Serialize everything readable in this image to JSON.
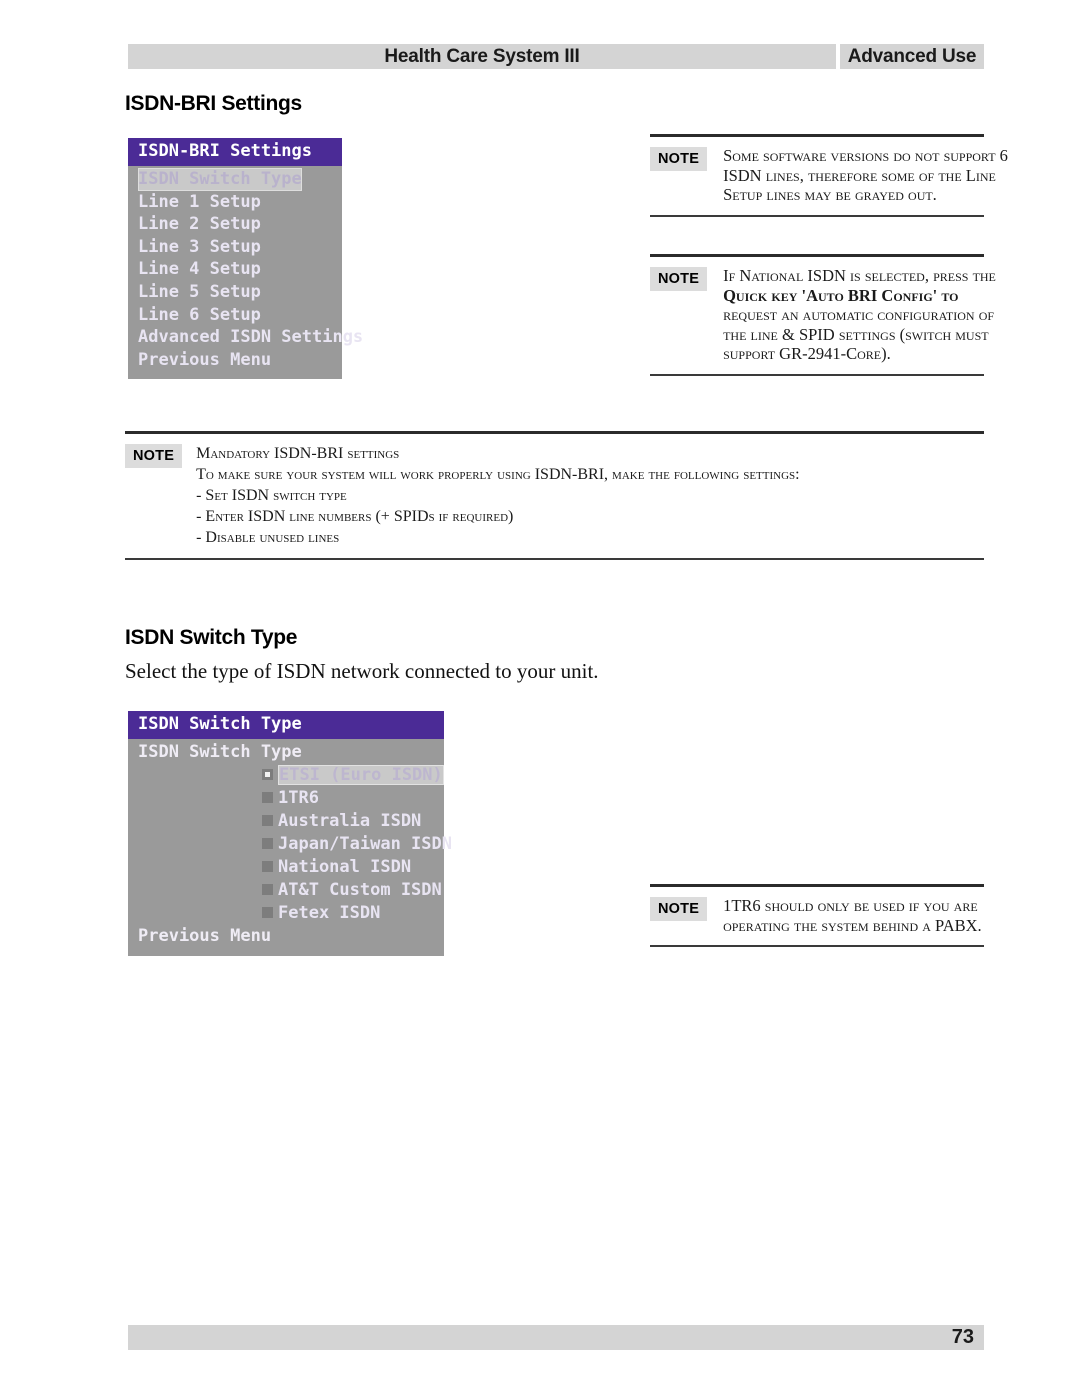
{
  "header": {
    "title": "Health Care System III",
    "section": "Advanced Use"
  },
  "footer": {
    "page_number": "73"
  },
  "headings": {
    "isdn_bri_settings": "ISDN-BRI Settings",
    "isdn_switch_type": "ISDN Switch Type"
  },
  "body": {
    "switch_type_intro": "Select the type of ISDN network connected to your unit."
  },
  "colors": {
    "osd_title_bar": "#4b2b96",
    "osd_body": "#9a9a9a",
    "osd_item_text": "#e8e4f2",
    "osd_highlight": "#c9c9c9",
    "band_gray": "#d4d4d4",
    "note_badge_gray": "#dcdcdc"
  },
  "osd_menu_1": {
    "title": "ISDN-BRI Settings",
    "items": [
      {
        "label": "ISDN Switch Type",
        "selected": true
      },
      {
        "label": "Line 1 Setup",
        "selected": false
      },
      {
        "label": "Line 2 Setup",
        "selected": false
      },
      {
        "label": "Line 3 Setup",
        "selected": false
      },
      {
        "label": "Line 4 Setup",
        "selected": false
      },
      {
        "label": "Line 5 Setup",
        "selected": false
      },
      {
        "label": "Line 6 Setup",
        "selected": false
      },
      {
        "label": "Advanced ISDN Settings",
        "selected": false
      },
      {
        "label": "Previous Menu",
        "selected": false
      }
    ]
  },
  "osd_menu_2": {
    "title": "ISDN Switch Type",
    "subhead": "ISDN Switch Type",
    "options": [
      {
        "label": "ETSI (Euro ISDN)",
        "checked": true
      },
      {
        "label": "1TR6",
        "checked": false
      },
      {
        "label": "Australia ISDN",
        "checked": false
      },
      {
        "label": "Japan/Taiwan ISDN",
        "checked": false
      },
      {
        "label": "National ISDN",
        "checked": false
      },
      {
        "label": "AT&T Custom ISDN",
        "checked": false
      },
      {
        "label": "Fetex ISDN",
        "checked": false
      }
    ],
    "previous_menu": "Previous Menu"
  },
  "notes": {
    "badge_label": "NOTE",
    "note_1": {
      "lines": [
        "Some software versions do not support 6",
        "ISDN lines, therefore some of the Line",
        "Setup lines may be grayed out."
      ]
    },
    "note_2": {
      "lines": [
        "If National ISDN is selected, press the",
        "Quick key 'Auto BRI Config' to",
        "request an automatic configuration of",
        "the line & SPID settings (switch must",
        "support GR-2941-Core)."
      ]
    },
    "note_wide": {
      "lines": [
        "Mandatory ISDN-BRI settings",
        "To make sure your system will work properly using ISDN-BRI, make the following settings:",
        "- Set ISDN switch type",
        "- Enter ISDN line numbers (+ SPIDs if required)",
        "- Disable unused lines"
      ]
    },
    "note_3": {
      "lines": [
        "1TR6 should only be used if you are",
        "operating the system behind a PABX."
      ]
    }
  }
}
